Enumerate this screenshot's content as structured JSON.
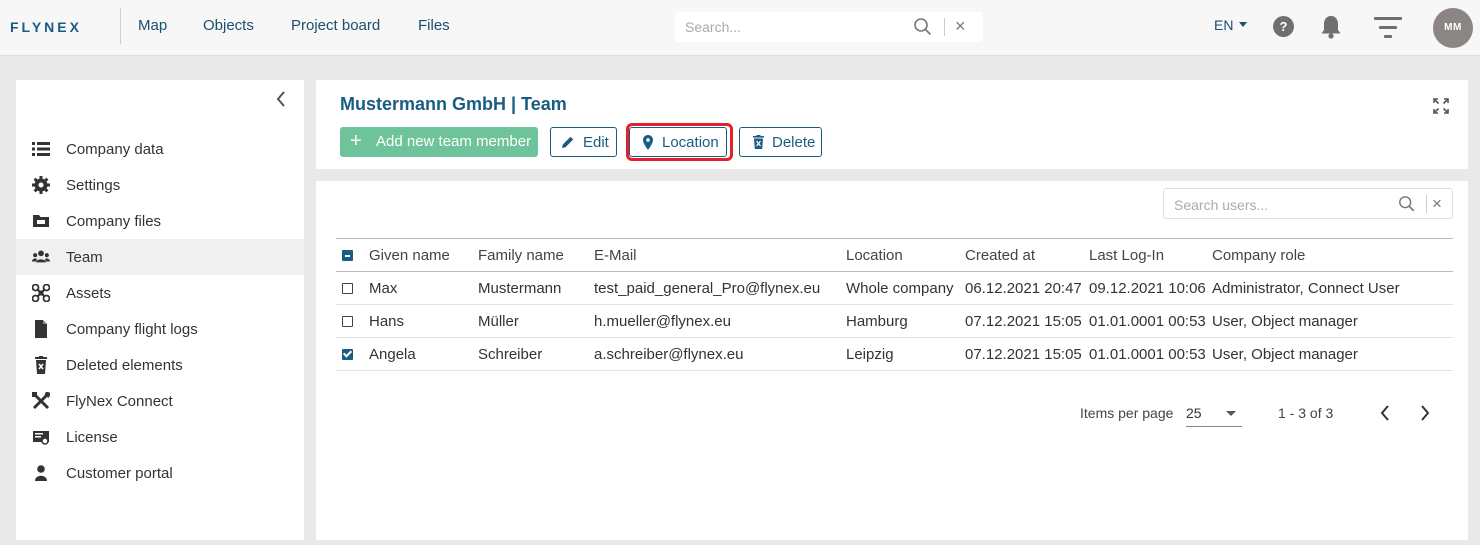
{
  "header": {
    "logo_text": "FLYNEX",
    "nav": [
      "Map",
      "Objects",
      "Project board",
      "Files"
    ],
    "search_placeholder": "Search...",
    "language": "EN",
    "help_glyph": "?",
    "avatar_initials": "MM"
  },
  "sidebar": {
    "items": [
      {
        "label": "Company data",
        "icon": "list-icon"
      },
      {
        "label": "Settings",
        "icon": "gear-icon"
      },
      {
        "label": "Company files",
        "icon": "folder-icon"
      },
      {
        "label": "Team",
        "icon": "team-icon"
      },
      {
        "label": "Assets",
        "icon": "drone-icon"
      },
      {
        "label": "Company flight logs",
        "icon": "document-icon"
      },
      {
        "label": "Deleted elements",
        "icon": "trash-icon"
      },
      {
        "label": "FlyNex Connect",
        "icon": "tools-icon"
      },
      {
        "label": "License",
        "icon": "certificate-icon"
      },
      {
        "label": "Customer portal",
        "icon": "user-icon"
      }
    ],
    "active": "Team"
  },
  "page": {
    "title": "Mustermann GmbH | Team",
    "buttons": {
      "add": "Add new team member",
      "edit": "Edit",
      "location": "Location",
      "delete": "Delete"
    }
  },
  "table": {
    "search_placeholder": "Search users...",
    "columns": [
      "Given name",
      "Family name",
      "E-Mail",
      "Location",
      "Created at",
      "Last Log-In",
      "Company role"
    ],
    "rows": [
      {
        "given": "Max",
        "family": "Mustermann",
        "email": "test_paid_general_Pro@flynex.eu",
        "location": "Whole company",
        "created": "06.12.2021 20:47",
        "last_login": "09.12.2021 10:06",
        "role": "Administrator, Connect User",
        "checked": false
      },
      {
        "given": "Hans",
        "family": "Müller",
        "email": "h.mueller@flynex.eu",
        "location": "Hamburg",
        "created": "07.12.2021 15:05",
        "last_login": "01.01.0001 00:53",
        "role": "User, Object manager",
        "checked": false
      },
      {
        "given": "Angela",
        "family": "Schreiber",
        "email": "a.schreiber@flynex.eu",
        "location": "Leipzig",
        "created": "07.12.2021 15:05",
        "last_login": "01.01.0001 00:53",
        "role": "User, Object manager",
        "checked": true
      }
    ]
  },
  "pagination": {
    "items_per_page_label": "Items per page",
    "items_per_page": "25",
    "range": "1 - 3 of 3"
  },
  "colors": {
    "primary": "#1a5d82",
    "add_button": "#6fc39a",
    "highlight": "#e5202a"
  }
}
